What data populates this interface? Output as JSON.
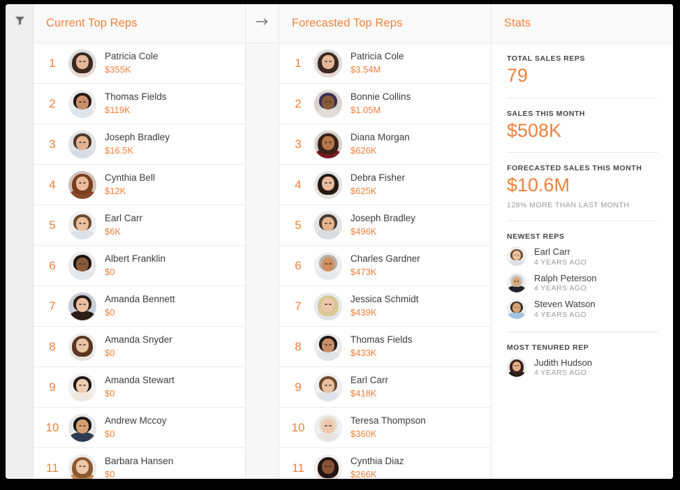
{
  "rail": {
    "filter_icon": "funnel-filter-icon"
  },
  "columns": {
    "current": {
      "title": "Current Top Reps",
      "reps": [
        {
          "rank": "1",
          "name": "Patricia Cole",
          "amount": "$355K"
        },
        {
          "rank": "2",
          "name": "Thomas Fields",
          "amount": "$119K"
        },
        {
          "rank": "3",
          "name": "Joseph Bradley",
          "amount": "$16.5K"
        },
        {
          "rank": "4",
          "name": "Cynthia Bell",
          "amount": "$12K"
        },
        {
          "rank": "5",
          "name": "Earl Carr",
          "amount": "$6K"
        },
        {
          "rank": "6",
          "name": "Albert Franklin",
          "amount": "$0"
        },
        {
          "rank": "7",
          "name": "Amanda Bennett",
          "amount": "$0"
        },
        {
          "rank": "8",
          "name": "Amanda Snyder",
          "amount": "$0"
        },
        {
          "rank": "9",
          "name": "Amanda Stewart",
          "amount": "$0"
        },
        {
          "rank": "10",
          "name": "Andrew Mccoy",
          "amount": "$0"
        },
        {
          "rank": "11",
          "name": "Barbara Hansen",
          "amount": "$0"
        }
      ]
    },
    "gap": {
      "arrow_icon": "arrow-right-icon"
    },
    "forecast": {
      "title": "Forecasted Top Reps",
      "reps": [
        {
          "rank": "1",
          "name": "Patricia Cole",
          "amount": "$3.54M"
        },
        {
          "rank": "2",
          "name": "Bonnie Collins",
          "amount": "$1.05M"
        },
        {
          "rank": "3",
          "name": "Diana Morgan",
          "amount": "$626K"
        },
        {
          "rank": "4",
          "name": "Debra Fisher",
          "amount": "$625K"
        },
        {
          "rank": "5",
          "name": "Joseph Bradley",
          "amount": "$496K"
        },
        {
          "rank": "6",
          "name": "Charles Gardner",
          "amount": "$473K"
        },
        {
          "rank": "7",
          "name": "Jessica Schmidt",
          "amount": "$439K"
        },
        {
          "rank": "8",
          "name": "Thomas Fields",
          "amount": "$433K"
        },
        {
          "rank": "9",
          "name": "Earl Carr",
          "amount": "$418K"
        },
        {
          "rank": "10",
          "name": "Teresa Thompson",
          "amount": "$360K"
        },
        {
          "rank": "11",
          "name": "Cynthia Diaz",
          "amount": "$266K"
        }
      ]
    },
    "stats": {
      "title": "Stats",
      "total_sales_reps": {
        "label": "TOTAL SALES REPS",
        "value": "79"
      },
      "sales_this_month": {
        "label": "SALES THIS MONTH",
        "value": "$508K"
      },
      "forecasted_sales_this_month": {
        "label": "FORECASTED SALES THIS MONTH",
        "value": "$10.6M",
        "sub": "128% MORE THAN LAST MONTH"
      },
      "newest_reps": {
        "label": "NEWEST REPS",
        "items": [
          {
            "name": "Earl Carr",
            "time": "4 YEARS AGO"
          },
          {
            "name": "Ralph Peterson",
            "time": "4 YEARS AGO"
          },
          {
            "name": "Steven Watson",
            "time": "4 YEARS AGO"
          }
        ]
      },
      "most_tenured_rep": {
        "label": "MOST TENURED REP",
        "items": [
          {
            "name": "Judith Hudson",
            "time": "4 YEARS AGO"
          }
        ]
      }
    }
  },
  "colors": {
    "accent": "#f0803b",
    "name_text": "#3b3b3b",
    "muted_text": "#9a9a9a",
    "header_bg": "#fafafa",
    "gap_bg": "#f7f7f7",
    "rail_bg": "#efefef",
    "frame": "#000000"
  },
  "avatar_palettes": {
    "current": [
      {
        "hair": "#3b2a20",
        "skin": "#e6b79a",
        "bg": "#dcdcdc",
        "body": "#e8d9d2",
        "long": true
      },
      {
        "hair": "#241a14",
        "skin": "#c98f68",
        "bg": "#ececec",
        "body": "#dfe4e8",
        "long": false
      },
      {
        "hair": "#4a392c",
        "skin": "#e3b48f",
        "bg": "#e4e4e4",
        "body": "#d7dde2",
        "long": false
      },
      {
        "hair": "#7a3f1e",
        "skin": "#e8bb9b",
        "bg": "#cfc3bb",
        "body": "#8a4a2a",
        "long": true
      },
      {
        "hair": "#6b4a2c",
        "skin": "#e9c0a0",
        "bg": "#efefef",
        "body": "#dde2e8",
        "long": false
      },
      {
        "hair": "#1b1410",
        "skin": "#8a5a3a",
        "bg": "#e9e9e9",
        "body": "#e3e7ea",
        "long": false
      },
      {
        "hair": "#2a1d16",
        "skin": "#e9bfa0",
        "bg": "#c9ced6",
        "body": "#2a1d16",
        "long": false
      },
      {
        "hair": "#5b3620",
        "skin": "#eac3a4",
        "bg": "#f0eeec",
        "body": "#e9e2dc",
        "long": true
      },
      {
        "hair": "#1d1512",
        "skin": "#f0cdb1",
        "bg": "#f2f0ee",
        "body": "#f0e7df",
        "long": false
      },
      {
        "hair": "#161616",
        "skin": "#d7a071",
        "bg": "#e7e7e7",
        "body": "#2e3b52",
        "long": false
      },
      {
        "hair": "#8a5a33",
        "skin": "#efc8a8",
        "bg": "#eeeae7",
        "body": "#c98f58",
        "long": true
      }
    ],
    "forecast": [
      {
        "hair": "#3b2a20",
        "skin": "#e6b79a",
        "bg": "#dcdcdc",
        "body": "#e8d9d2",
        "long": true
      },
      {
        "hair": "#3c2f52",
        "skin": "#8a5a3c",
        "bg": "#d9d6d2",
        "body": "#e2ddd8",
        "long": false
      },
      {
        "hair": "#3a2218",
        "skin": "#b5784a",
        "bg": "#d6d2cd",
        "body": "#7a1a24",
        "long": true
      },
      {
        "hair": "#241a14",
        "skin": "#e7bb9b",
        "bg": "#e3e3e3",
        "body": "#e6e2de",
        "long": true
      },
      {
        "hair": "#4a392c",
        "skin": "#e3b48f",
        "bg": "#e4e4e4",
        "body": "#d7dde2",
        "long": false
      },
      {
        "hair": "#b9b0a6",
        "skin": "#cf9060",
        "bg": "#efefef",
        "body": "#e6e9ec",
        "long": false
      },
      {
        "hair": "#d8c896",
        "skin": "#edc6ab",
        "bg": "#e8eaec",
        "body": "#dfe3e6",
        "long": true
      },
      {
        "hair": "#241a14",
        "skin": "#c98f68",
        "bg": "#ececec",
        "body": "#dfe4e8",
        "long": false
      },
      {
        "hair": "#6b4a2c",
        "skin": "#e9c0a0",
        "bg": "#efefef",
        "body": "#dde2e8",
        "long": false
      },
      {
        "hair": "#e4dcc8",
        "skin": "#f0c8b0",
        "bg": "#efefef",
        "body": "#e9e4de",
        "long": false
      },
      {
        "hair": "#201512",
        "skin": "#8a5334",
        "bg": "#f0efed",
        "body": "#ecdfd8",
        "long": true
      }
    ],
    "newest": [
      {
        "hair": "#6b4a2c",
        "skin": "#e9c0a0",
        "bg": "#efefef",
        "body": "#dde2e8",
        "long": false
      },
      {
        "hair": "#cfcac4",
        "skin": "#d8a77f",
        "bg": "#f0efee",
        "body": "#20242a",
        "long": false
      },
      {
        "hair": "#3b2a1d",
        "skin": "#d8a177",
        "bg": "#eceff1",
        "body": "#9fc3e0",
        "long": false
      }
    ],
    "tenured": [
      {
        "hair": "#3a2119",
        "skin": "#e2ab87",
        "bg": "#eceaea",
        "body": "#241a16",
        "long": true
      }
    ]
  }
}
